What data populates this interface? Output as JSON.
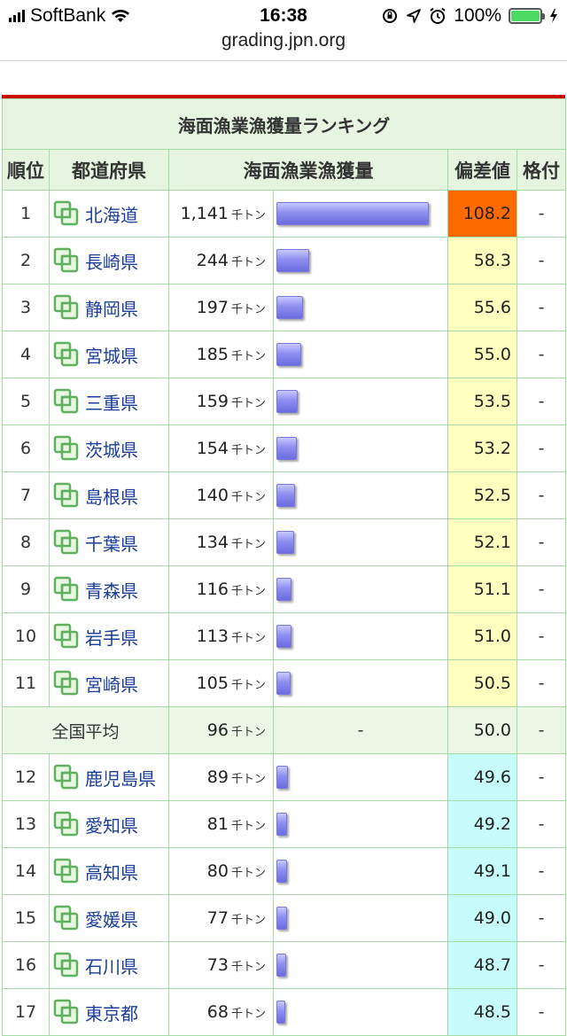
{
  "status_bar": {
    "carrier": "SoftBank",
    "time": "16:38",
    "battery": "100%",
    "battery_level": 1.0
  },
  "browser": {
    "url": "grading.jpn.org"
  },
  "table": {
    "caption": "海面漁業漁獲量ランキング",
    "headers": {
      "rank": "順位",
      "prefecture": "都道府県",
      "value": "海面漁業漁獲量",
      "deviation": "偏差値",
      "grade": "格付"
    },
    "unit": "千トン",
    "max_value": 1141,
    "colors": {
      "top": "#ff6a00",
      "above": "#ffffc0",
      "below": "#c7fcfc"
    },
    "rows_top": [
      {
        "rank": "1",
        "pref": "北海道",
        "value": "1,141",
        "v": 1141,
        "dev": "108.2",
        "grade": "-",
        "level": "top"
      },
      {
        "rank": "2",
        "pref": "長崎県",
        "value": "244",
        "v": 244,
        "dev": "58.3",
        "grade": "-",
        "level": "above"
      },
      {
        "rank": "3",
        "pref": "静岡県",
        "value": "197",
        "v": 197,
        "dev": "55.6",
        "grade": "-",
        "level": "above"
      },
      {
        "rank": "4",
        "pref": "宮城県",
        "value": "185",
        "v": 185,
        "dev": "55.0",
        "grade": "-",
        "level": "above"
      },
      {
        "rank": "5",
        "pref": "三重県",
        "value": "159",
        "v": 159,
        "dev": "53.5",
        "grade": "-",
        "level": "above"
      },
      {
        "rank": "6",
        "pref": "茨城県",
        "value": "154",
        "v": 154,
        "dev": "53.2",
        "grade": "-",
        "level": "above"
      },
      {
        "rank": "7",
        "pref": "島根県",
        "value": "140",
        "v": 140,
        "dev": "52.5",
        "grade": "-",
        "level": "above"
      },
      {
        "rank": "8",
        "pref": "千葉県",
        "value": "134",
        "v": 134,
        "dev": "52.1",
        "grade": "-",
        "level": "above"
      },
      {
        "rank": "9",
        "pref": "青森県",
        "value": "116",
        "v": 116,
        "dev": "51.1",
        "grade": "-",
        "level": "above"
      },
      {
        "rank": "10",
        "pref": "岩手県",
        "value": "113",
        "v": 113,
        "dev": "51.0",
        "grade": "-",
        "level": "above"
      },
      {
        "rank": "11",
        "pref": "宮崎県",
        "value": "105",
        "v": 105,
        "dev": "50.5",
        "grade": "-",
        "level": "above"
      }
    ],
    "average": {
      "label": "全国平均",
      "value": "96",
      "bar": "-",
      "dev": "50.0",
      "grade": "-"
    },
    "rows_bottom": [
      {
        "rank": "12",
        "pref": "鹿児島県",
        "value": "89",
        "v": 89,
        "dev": "49.6",
        "grade": "-",
        "level": "below"
      },
      {
        "rank": "13",
        "pref": "愛知県",
        "value": "81",
        "v": 81,
        "dev": "49.2",
        "grade": "-",
        "level": "below"
      },
      {
        "rank": "14",
        "pref": "高知県",
        "value": "80",
        "v": 80,
        "dev": "49.1",
        "grade": "-",
        "level": "below"
      },
      {
        "rank": "15",
        "pref": "愛媛県",
        "value": "77",
        "v": 77,
        "dev": "49.0",
        "grade": "-",
        "level": "below"
      },
      {
        "rank": "16",
        "pref": "石川県",
        "value": "73",
        "v": 73,
        "dev": "48.7",
        "grade": "-",
        "level": "below"
      },
      {
        "rank": "17",
        "pref": "東京都",
        "value": "68",
        "v": 68,
        "dev": "48.5",
        "grade": "-",
        "level": "below"
      }
    ]
  }
}
